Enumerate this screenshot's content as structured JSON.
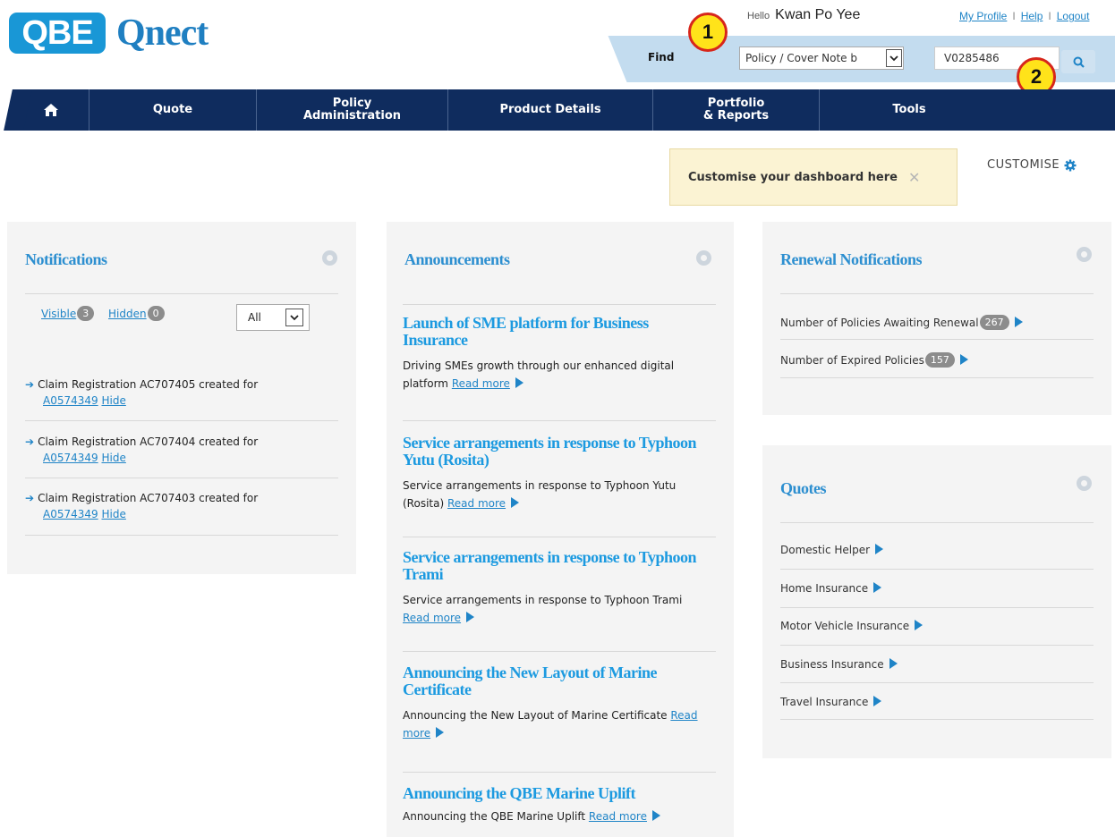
{
  "logo": {
    "brand": "QBE",
    "product": "Qnect"
  },
  "user": {
    "greeting": "Hello",
    "name": "Kwan Po Yee"
  },
  "top_links": [
    "My Profile",
    "Help",
    "Logout"
  ],
  "find": {
    "label": "Find",
    "select_value": "Policy / Cover Note b",
    "input_value": "V0285486"
  },
  "callouts": [
    "1",
    "2"
  ],
  "nav": {
    "items": [
      {
        "label": "",
        "icon": "home-icon"
      },
      {
        "label": "Quote"
      },
      {
        "label": "Policy\nAdministration"
      },
      {
        "label": "Product Details"
      },
      {
        "label": "Portfolio\n& Reports"
      },
      {
        "label": "Tools"
      }
    ]
  },
  "customise": {
    "tip": "Customise your dashboard here",
    "label": "CUSTOMISE"
  },
  "notifications": {
    "title": "Notifications",
    "visible_label": "Visible",
    "visible_count": "3",
    "hidden_label": "Hidden",
    "hidden_count": "0",
    "filter_value": "All",
    "items": [
      {
        "text": "Claim Registration AC707405 created for",
        "ref": "A0574349",
        "hide": "Hide"
      },
      {
        "text": "Claim Registration AC707404 created for",
        "ref": "A0574349",
        "hide": "Hide"
      },
      {
        "text": "Claim Registration AC707403 created for",
        "ref": "A0574349",
        "hide": "Hide"
      }
    ]
  },
  "announcements": {
    "title": "Announcements",
    "read_more": "Read more",
    "items": [
      {
        "heading": "Launch of SME platform for Business Insurance",
        "body": "Driving SMEs growth through our enhanced digital platform"
      },
      {
        "heading": "Service arrangements in response to Typhoon Yutu (Rosita)",
        "body": "Service arrangements in response to Typhoon Yutu (Rosita)"
      },
      {
        "heading": "Service arrangements in response to Typhoon Trami",
        "body": "Service arrangements in response to Typhoon Trami"
      },
      {
        "heading": "Announcing the New Layout of Marine Certificate",
        "body": "Announcing the New Layout of Marine Certificate"
      },
      {
        "heading": "Announcing the QBE Marine Uplift",
        "body": "Announcing the QBE Marine Uplift"
      }
    ]
  },
  "renewals": {
    "title": "Renewal Notifications",
    "items": [
      {
        "label": "Number of Policies Awaiting Renewal",
        "count": "267"
      },
      {
        "label": "Number of Expired Policies",
        "count": "157"
      }
    ]
  },
  "quotes": {
    "title": "Quotes",
    "items": [
      "Domestic Helper",
      "Home Insurance",
      "Motor Vehicle Insurance",
      "Business Insurance",
      "Travel Insurance"
    ]
  },
  "colors": {
    "brand_blue": "#1997d6",
    "nav_navy": "#0f2c5e",
    "link_blue": "#1f84c7",
    "callout_yellow": "#ffe31a",
    "callout_red": "#d7261b"
  }
}
